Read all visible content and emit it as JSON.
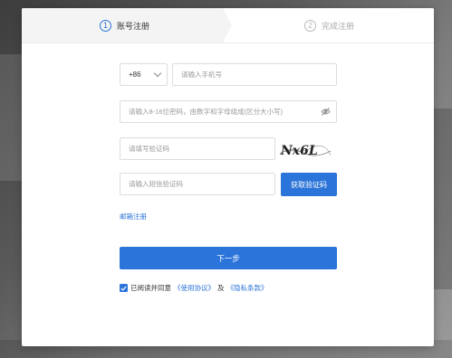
{
  "steps": [
    {
      "number": "1",
      "label": "账号注册",
      "active": true
    },
    {
      "number": "2",
      "label": "完成注册",
      "active": false
    }
  ],
  "form": {
    "country_code": "+86",
    "phone_placeholder": "请输入手机号",
    "password_placeholder": "请输入8-16位密码，由数字和字母组成(区分大小写)",
    "captcha_placeholder": "请填写验证码",
    "captcha_image_text": "Nx6L",
    "sms_placeholder": "请输入短信验证码",
    "get_code_label": "获取验证码",
    "email_register_label": "邮箱注册",
    "next_label": "下一步",
    "agree_prefix": "已阅读并同意",
    "agree_link1": "《使用协议》",
    "agree_and": "及",
    "agree_link2": "《隐私条款》"
  },
  "colors": {
    "accent": "#2b74d9"
  }
}
